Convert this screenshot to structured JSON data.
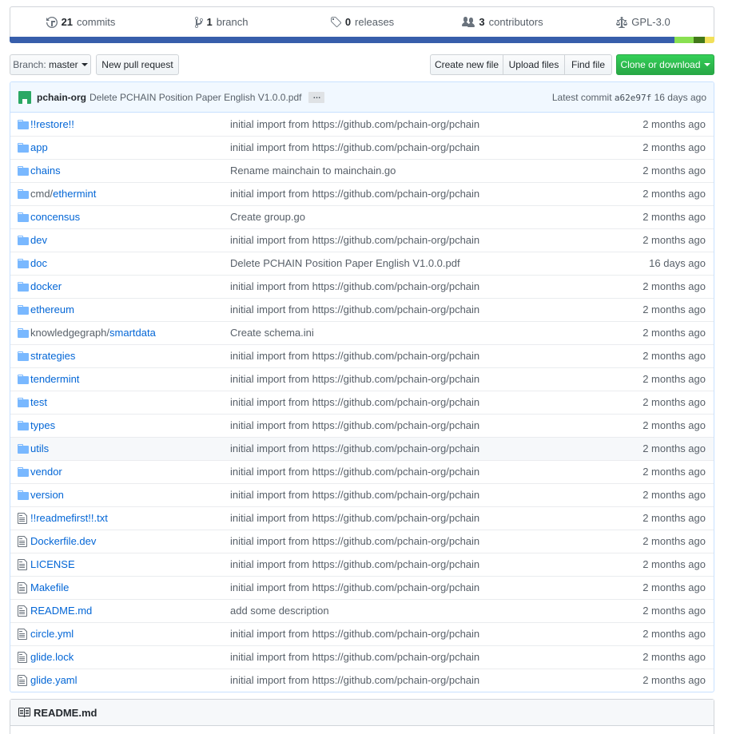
{
  "summary": {
    "commits": {
      "count": "21",
      "label": "commits",
      "icon": "history-icon"
    },
    "branches": {
      "count": "1",
      "label": "branch",
      "icon": "git-branch-icon"
    },
    "releases": {
      "count": "0",
      "label": "releases",
      "icon": "tag-icon"
    },
    "contributors": {
      "count": "3",
      "label": "contributors",
      "icon": "people-icon"
    },
    "license": {
      "label": "GPL-3.0",
      "icon": "law-icon"
    }
  },
  "languages": [
    {
      "color": "#375eab",
      "fraction": 0.943
    },
    {
      "color": "#89e051",
      "fraction": 0.028
    },
    {
      "color": "#427819",
      "fraction": 0.015
    },
    {
      "color": "#f1e05a",
      "fraction": 0.014
    }
  ],
  "toolbar": {
    "branch_prefix": "Branch:",
    "branch_name": "master",
    "new_pull_request": "New pull request",
    "create_new_file": "Create new file",
    "upload_files": "Upload files",
    "find_file": "Find file",
    "clone_or_download": "Clone or download"
  },
  "latest_commit": {
    "author": "pchain-org",
    "message": "Delete PCHAIN Position Paper English V1.0.0.pdf",
    "ellipsis": "…",
    "label": "Latest commit",
    "sha": "a62e97f",
    "age": "16 days ago"
  },
  "files": [
    {
      "type": "dir",
      "name": "!!restore!!",
      "message": "initial import from https://github.com/pchain-org/pchain",
      "age": "2 months ago"
    },
    {
      "type": "dir",
      "name": "app",
      "message": "initial import from https://github.com/pchain-org/pchain",
      "age": "2 months ago"
    },
    {
      "type": "dir",
      "name": "chains",
      "message": "Rename mainchain to mainchain.go",
      "age": "2 months ago"
    },
    {
      "type": "dir",
      "prefix": "cmd/",
      "name": "ethermint",
      "message": "initial import from https://github.com/pchain-org/pchain",
      "age": "2 months ago"
    },
    {
      "type": "dir",
      "name": "concensus",
      "message": "Create group.go",
      "age": "2 months ago"
    },
    {
      "type": "dir",
      "name": "dev",
      "message": "initial import from https://github.com/pchain-org/pchain",
      "age": "2 months ago"
    },
    {
      "type": "dir",
      "name": "doc",
      "message": "Delete PCHAIN Position Paper English V1.0.0.pdf",
      "age": "16 days ago"
    },
    {
      "type": "dir",
      "name": "docker",
      "message": "initial import from https://github.com/pchain-org/pchain",
      "age": "2 months ago"
    },
    {
      "type": "dir",
      "name": "ethereum",
      "message": "initial import from https://github.com/pchain-org/pchain",
      "age": "2 months ago"
    },
    {
      "type": "dir",
      "prefix": "knowledgegraph/",
      "name": "smartdata",
      "message": "Create schema.ini",
      "age": "2 months ago"
    },
    {
      "type": "dir",
      "name": "strategies",
      "message": "initial import from https://github.com/pchain-org/pchain",
      "age": "2 months ago"
    },
    {
      "type": "dir",
      "name": "tendermint",
      "message": "initial import from https://github.com/pchain-org/pchain",
      "age": "2 months ago"
    },
    {
      "type": "dir",
      "name": "test",
      "message": "initial import from https://github.com/pchain-org/pchain",
      "age": "2 months ago"
    },
    {
      "type": "dir",
      "name": "types",
      "message": "initial import from https://github.com/pchain-org/pchain",
      "age": "2 months ago"
    },
    {
      "type": "dir",
      "name": "utils",
      "message": "initial import from https://github.com/pchain-org/pchain",
      "age": "2 months ago",
      "hover": true
    },
    {
      "type": "dir",
      "name": "vendor",
      "message": "initial import from https://github.com/pchain-org/pchain",
      "age": "2 months ago"
    },
    {
      "type": "dir",
      "name": "version",
      "message": "initial import from https://github.com/pchain-org/pchain",
      "age": "2 months ago"
    },
    {
      "type": "file",
      "name": "!!readmefirst!!.txt",
      "message": "initial import from https://github.com/pchain-org/pchain",
      "age": "2 months ago"
    },
    {
      "type": "file",
      "name": "Dockerfile.dev",
      "message": "initial import from https://github.com/pchain-org/pchain",
      "age": "2 months ago"
    },
    {
      "type": "file",
      "name": "LICENSE",
      "message": "initial import from https://github.com/pchain-org/pchain",
      "age": "2 months ago"
    },
    {
      "type": "file",
      "name": "Makefile",
      "message": "initial import from https://github.com/pchain-org/pchain",
      "age": "2 months ago"
    },
    {
      "type": "file",
      "name": "README.md",
      "message": "add some description",
      "age": "2 months ago"
    },
    {
      "type": "file",
      "name": "circle.yml",
      "message": "initial import from https://github.com/pchain-org/pchain",
      "age": "2 months ago"
    },
    {
      "type": "file",
      "name": "glide.lock",
      "message": "initial import from https://github.com/pchain-org/pchain",
      "age": "2 months ago"
    },
    {
      "type": "file",
      "name": "glide.yaml",
      "message": "initial import from https://github.com/pchain-org/pchain",
      "age": "2 months ago"
    }
  ],
  "readme": {
    "title": "README.md",
    "icon": "book-icon"
  }
}
